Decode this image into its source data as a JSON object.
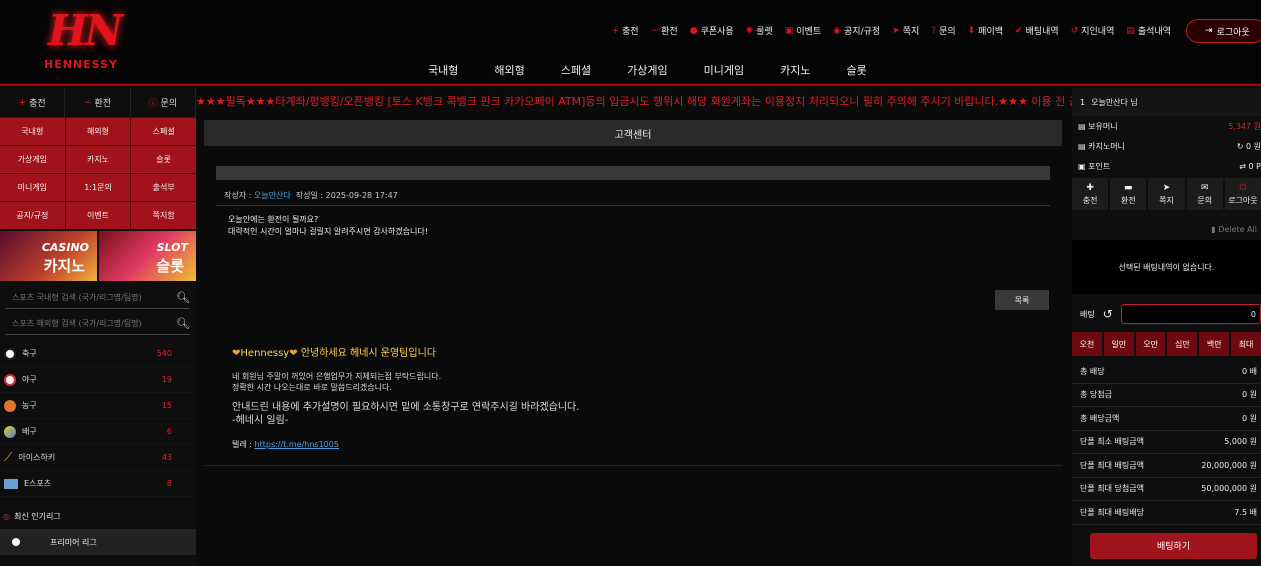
{
  "header": {
    "logo_text": "HN",
    "brand": "HENNESSY",
    "top_menu": [
      {
        "icon": "plus-icon",
        "label": "충전"
      },
      {
        "icon": "minus-icon",
        "label": "환전"
      },
      {
        "icon": "coupon-icon",
        "label": "쿠폰사용"
      },
      {
        "icon": "roulette-icon",
        "label": "룰렛"
      },
      {
        "icon": "calendar-icon",
        "label": "이벤트"
      },
      {
        "icon": "notice-icon",
        "label": "공지/규정"
      },
      {
        "icon": "send-icon",
        "label": "쪽지"
      },
      {
        "icon": "question-icon",
        "label": "문의"
      },
      {
        "icon": "payback-icon",
        "label": "페이백"
      },
      {
        "icon": "check-icon",
        "label": "배팅내역"
      },
      {
        "icon": "history-icon",
        "label": "지인내역"
      },
      {
        "icon": "calendar-check-icon",
        "label": "출석내역"
      }
    ],
    "logout_label": "로그아웃",
    "main_nav": [
      "국내형",
      "해외형",
      "스페셜",
      "가상게임",
      "미니게임",
      "카지노",
      "슬롯"
    ]
  },
  "left": {
    "top_buttons": [
      {
        "icon": "plus-icon",
        "label": "충전"
      },
      {
        "icon": "minus-icon",
        "label": "환전"
      },
      {
        "icon": "info-icon",
        "label": "문의"
      }
    ],
    "grid": [
      "국내형",
      "해외형",
      "스페셜",
      "가상게임",
      "카지노",
      "슬롯",
      "미니게임",
      "1:1문의",
      "출석부",
      "공지/규정",
      "이벤트",
      "쪽지함"
    ],
    "banners": [
      {
        "title": "CASINO",
        "subtitle": "카지노"
      },
      {
        "title": "SLOT",
        "subtitle": "슬롯"
      }
    ],
    "search_domestic_placeholder": "스포츠 국내형 검색 (국가/리그명/팀명)",
    "search_overseas_placeholder": "스포츠 해외형 검색 (국가/리그명/팀명)",
    "sports": [
      {
        "name": "축구",
        "count": "540",
        "color": "#ffffff"
      },
      {
        "name": "야구",
        "count": "19",
        "color": "#f2f2f2"
      },
      {
        "name": "농구",
        "count": "15",
        "color": "#e0742c"
      },
      {
        "name": "배구",
        "count": "6",
        "color": "#3a7be0"
      },
      {
        "name": "아이스하키",
        "count": "43",
        "color": "#d8b040"
      },
      {
        "name": "E스포츠",
        "count": "8",
        "color": "#6aa0d0"
      }
    ],
    "leagues_header": "최신 인기리그",
    "leagues": [
      {
        "name": "프리미어 리그"
      }
    ]
  },
  "marquee": "★★★필독★★★타계좌/펑뱅킹/오픈뱅킹 [토스 K뱅크 콕뱅크 핀크 카카오페이 ATM]등의 입금시도 행위시 해당 회원계좌는 이용정지 처리되오니 필히 주의해 주시기 바랍니다.★★★ 이용 전 공지사",
  "center": {
    "title": "고객센터",
    "author_label": "작성자 :",
    "author": "오늘만산다",
    "date_label": "작성일 :",
    "date": "2025-09-28 17:47",
    "body_lines": [
      "오늘안에는 환전이 될까요?",
      "대략적인 시간이 얼마나 걸릴지 알려주시면 감사하겠습니다!"
    ],
    "list_button": "목록",
    "reply": {
      "heading_brand": "Hennessy",
      "heading_text": "안녕하세요 헤네시 운영팀입니다",
      "lines": [
        "네 회원님 주말이 꺼있어 은행업무가 지체되는점 부탁드립니다.",
        "정확한 시간 나오는대로 바로 말씀드리겠습니다."
      ],
      "info_lines": [
        "안내드린 내용에 추가설명이 필요하시면 밑에 소통창구로 연락주시길 바라겠습니다.",
        "-헤네시 일림-"
      ],
      "telegram_label": "텔레 :",
      "telegram_link": "https://t.me/hns1005"
    }
  },
  "right": {
    "level": "1",
    "username": "오늘만산다 님",
    "balances": [
      {
        "icon": "money-icon",
        "label": "보유머니",
        "value": "5,347 원"
      },
      {
        "icon": "money-icon",
        "label": "카지노머니",
        "value": "0 원"
      },
      {
        "icon": "point-icon",
        "label": "포인트",
        "value": "0 P"
      }
    ],
    "buttons": [
      {
        "icon": "plus-icon",
        "label": "충전"
      },
      {
        "icon": "minus-icon",
        "label": "환전"
      },
      {
        "icon": "send-icon",
        "label": "쪽지"
      },
      {
        "icon": "mail-icon",
        "label": "문의"
      },
      {
        "icon": "power-icon",
        "label": "로그아웃"
      }
    ],
    "delete_all": "Delete All",
    "empty_bets": "선택된 배팅내역이 없습니다.",
    "bet_label": "배팅",
    "bet_value": "0",
    "chips": [
      "오천",
      "일만",
      "오만",
      "십만",
      "백만",
      "최대"
    ],
    "stats": [
      {
        "label": "총 배당",
        "value": "0 배"
      },
      {
        "label": "총 당첨금",
        "value": "0 원"
      },
      {
        "label": "총 배당금액",
        "value": "0 원"
      },
      {
        "label": "단폴 최소 배팅금액",
        "value": "5,000 원"
      },
      {
        "label": "단폴 최대 배팅금액",
        "value": "20,000,000 원"
      },
      {
        "label": "단폴 최대 당첨금액",
        "value": "50,000,000 원"
      },
      {
        "label": "단폴 최대 배팅배당",
        "value": "7.5 배"
      }
    ],
    "bet_button": "배팅하기"
  }
}
